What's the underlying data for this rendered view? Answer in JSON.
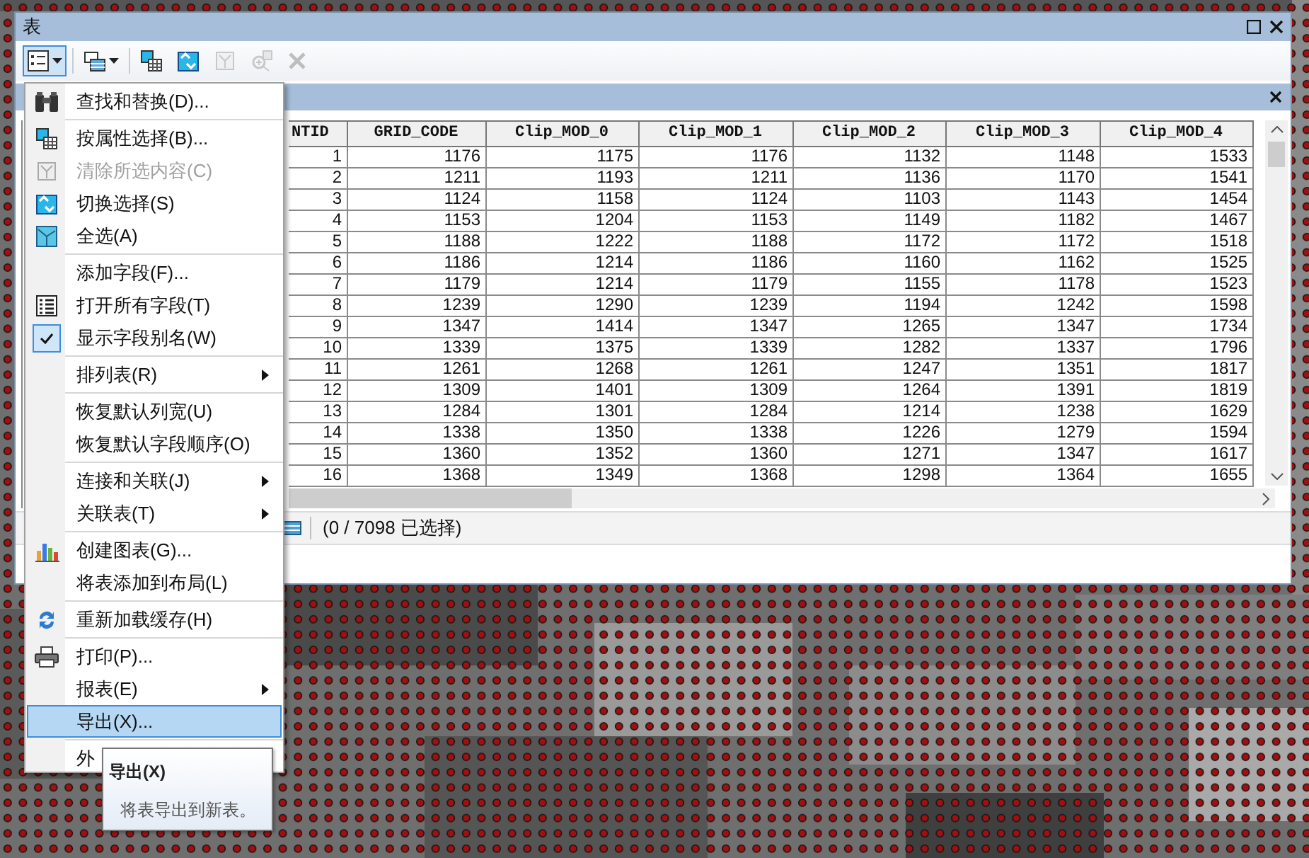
{
  "window": {
    "title": "表"
  },
  "toolbar": [
    {
      "disabled": false,
      "active": true,
      "dropdown": true
    },
    {
      "disabled": false,
      "active": false,
      "dropdown": true
    },
    {
      "disabled": false,
      "active": false,
      "dropdown": false
    },
    {
      "disabled": false,
      "active": false,
      "dropdown": false
    },
    {
      "disabled": true,
      "active": false,
      "dropdown": false
    },
    {
      "disabled": true,
      "active": false,
      "dropdown": false
    },
    {
      "disabled": true,
      "active": false,
      "dropdown": false
    }
  ],
  "table": {
    "columns": [
      "NTID",
      "GRID_CODE",
      "Clip_MOD_0",
      "Clip_MOD_1",
      "Clip_MOD_2",
      "Clip_MOD_3",
      "Clip_MOD_4"
    ],
    "rows": [
      [
        "1",
        "1176",
        "1175",
        "1176",
        "1132",
        "1148",
        "1533"
      ],
      [
        "2",
        "1211",
        "1193",
        "1211",
        "1136",
        "1170",
        "1541"
      ],
      [
        "3",
        "1124",
        "1158",
        "1124",
        "1103",
        "1143",
        "1454"
      ],
      [
        "4",
        "1153",
        "1204",
        "1153",
        "1149",
        "1182",
        "1467"
      ],
      [
        "5",
        "1188",
        "1222",
        "1188",
        "1172",
        "1172",
        "1518"
      ],
      [
        "6",
        "1186",
        "1214",
        "1186",
        "1160",
        "1162",
        "1525"
      ],
      [
        "7",
        "1179",
        "1214",
        "1179",
        "1155",
        "1178",
        "1523"
      ],
      [
        "8",
        "1239",
        "1290",
        "1239",
        "1194",
        "1242",
        "1598"
      ],
      [
        "9",
        "1347",
        "1414",
        "1347",
        "1265",
        "1347",
        "1734"
      ],
      [
        "10",
        "1339",
        "1375",
        "1339",
        "1282",
        "1337",
        "1796"
      ],
      [
        "11",
        "1261",
        "1268",
        "1261",
        "1247",
        "1351",
        "1817"
      ],
      [
        "12",
        "1309",
        "1401",
        "1309",
        "1264",
        "1391",
        "1819"
      ],
      [
        "13",
        "1284",
        "1301",
        "1284",
        "1214",
        "1238",
        "1629"
      ],
      [
        "14",
        "1338",
        "1350",
        "1338",
        "1226",
        "1279",
        "1594"
      ],
      [
        "15",
        "1360",
        "1352",
        "1360",
        "1271",
        "1347",
        "1617"
      ],
      [
        "16",
        "1368",
        "1349",
        "1368",
        "1298",
        "1364",
        "1655"
      ]
    ]
  },
  "status_bar": {
    "selection": "(0 / 7098 已选择)"
  },
  "menu": {
    "groups": [
      [
        {
          "label": "查找和替换(D)...",
          "disabled": false,
          "checked": false,
          "submenu": false,
          "selected": false
        }
      ],
      [
        {
          "label": "按属性选择(B)...",
          "disabled": false,
          "checked": false,
          "submenu": false,
          "selected": false
        },
        {
          "label": "清除所选内容(C)",
          "disabled": true,
          "checked": false,
          "submenu": false,
          "selected": false
        },
        {
          "label": "切换选择(S)",
          "disabled": false,
          "checked": false,
          "submenu": false,
          "selected": false
        },
        {
          "label": "全选(A)",
          "disabled": false,
          "checked": false,
          "submenu": false,
          "selected": false
        }
      ],
      [
        {
          "label": "添加字段(F)...",
          "disabled": false,
          "checked": false,
          "submenu": false,
          "selected": false
        },
        {
          "label": "打开所有字段(T)",
          "disabled": false,
          "checked": false,
          "submenu": false,
          "selected": false
        },
        {
          "label": "显示字段别名(W)",
          "disabled": false,
          "checked": true,
          "submenu": false,
          "selected": false
        }
      ],
      [
        {
          "label": "排列表(R)",
          "disabled": false,
          "checked": false,
          "submenu": true,
          "selected": false
        }
      ],
      [
        {
          "label": "恢复默认列宽(U)",
          "disabled": false,
          "checked": false,
          "submenu": false,
          "selected": false
        },
        {
          "label": "恢复默认字段顺序(O)",
          "disabled": false,
          "checked": false,
          "submenu": false,
          "selected": false
        }
      ],
      [
        {
          "label": "连接和关联(J)",
          "disabled": false,
          "checked": false,
          "submenu": true,
          "selected": false
        },
        {
          "label": "关联表(T)",
          "disabled": false,
          "checked": false,
          "submenu": true,
          "selected": false
        }
      ],
      [
        {
          "label": "创建图表(G)...",
          "disabled": false,
          "checked": false,
          "submenu": false,
          "selected": false
        },
        {
          "label": "将表添加到布局(L)",
          "disabled": false,
          "checked": false,
          "submenu": false,
          "selected": false
        }
      ],
      [
        {
          "label": "重新加载缓存(H)",
          "disabled": false,
          "checked": false,
          "submenu": false,
          "selected": false
        }
      ],
      [
        {
          "label": "打印(P)...",
          "disabled": false,
          "checked": false,
          "submenu": false,
          "selected": false
        },
        {
          "label": "报表(E)",
          "disabled": false,
          "checked": false,
          "submenu": true,
          "selected": false
        },
        {
          "label": "导出(X)...",
          "disabled": false,
          "checked": false,
          "submenu": false,
          "selected": true
        }
      ],
      [
        {
          "label": "外",
          "disabled": false,
          "checked": false,
          "submenu": false,
          "selected": false
        }
      ]
    ]
  },
  "tooltip": {
    "title": "导出(X)",
    "description": "将表导出到新表。"
  }
}
